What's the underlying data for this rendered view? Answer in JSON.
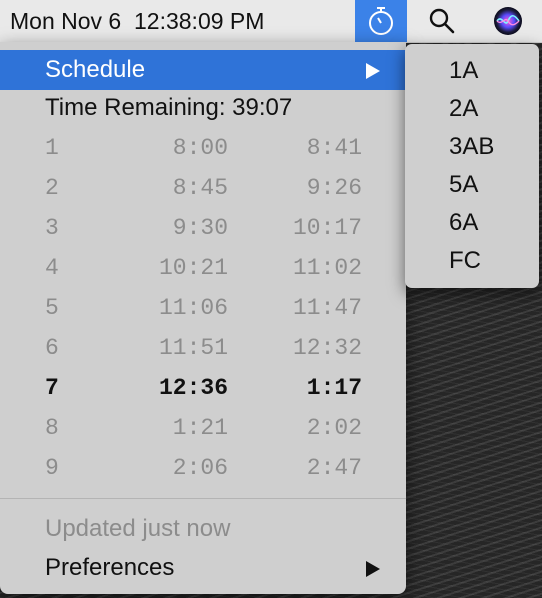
{
  "menubar": {
    "clock": "Mon Nov 6  12:38:09 PM",
    "timer_icon": "stopwatch-icon",
    "search_icon": "magnifying-glass-icon",
    "siri_icon": "siri-icon",
    "accent_color": "#3b82e8"
  },
  "menu": {
    "schedule_label": "Schedule",
    "time_remaining": "Time Remaining: 39:07",
    "periods": [
      {
        "period": "1",
        "start": "8:00",
        "end": "8:41",
        "current": false
      },
      {
        "period": "2",
        "start": "8:45",
        "end": "9:26",
        "current": false
      },
      {
        "period": "3",
        "start": "9:30",
        "end": "10:17",
        "current": false
      },
      {
        "period": "4",
        "start": "10:21",
        "end": "11:02",
        "current": false
      },
      {
        "period": "5",
        "start": "11:06",
        "end": "11:47",
        "current": false
      },
      {
        "period": "6",
        "start": "11:51",
        "end": "12:32",
        "current": false
      },
      {
        "period": "7",
        "start": "12:36",
        "end": "1:17",
        "current": true
      },
      {
        "period": "8",
        "start": "1:21",
        "end": "2:02",
        "current": false
      },
      {
        "period": "9",
        "start": "2:06",
        "end": "2:47",
        "current": false
      }
    ],
    "updated_label": "Updated just now",
    "preferences_label": "Preferences",
    "highlight_color": "#2f73d8"
  },
  "submenu": {
    "items": [
      "1A",
      "2A",
      "3AB",
      "5A",
      "6A",
      "FC"
    ]
  }
}
